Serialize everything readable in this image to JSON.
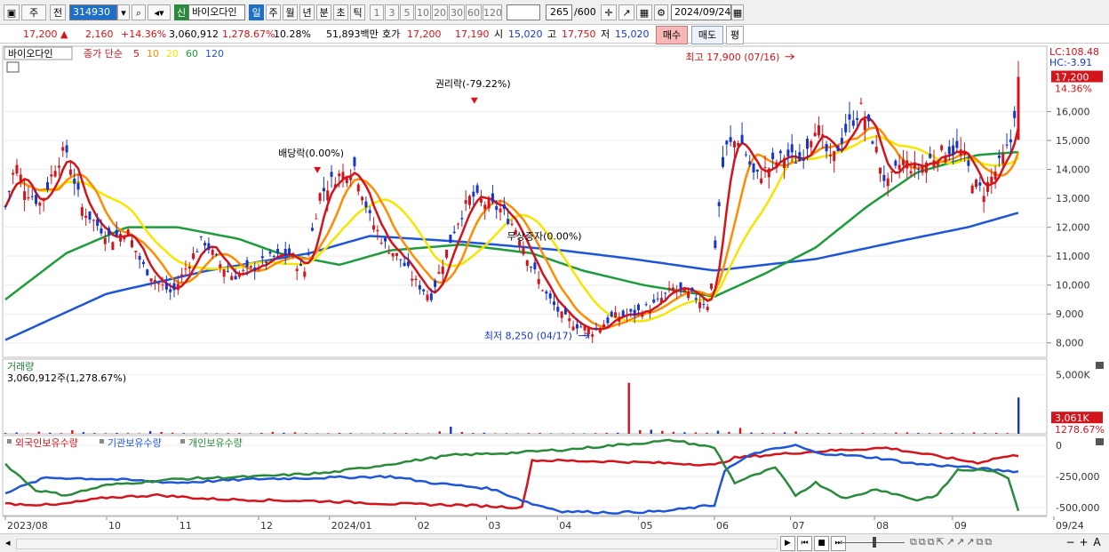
{
  "toolbar": {
    "market": "주",
    "prev_label": "전",
    "code": "314930",
    "stock_name": "바이오다인",
    "new_badge": "신",
    "periods": [
      "일",
      "주",
      "월",
      "년",
      "분",
      "초",
      "틱"
    ],
    "active_period": "일",
    "intervals": [
      "1",
      "3",
      "5",
      "10",
      "20",
      "30",
      "60",
      "120"
    ],
    "count": "265",
    "count_max": "/600",
    "date": "2024/09/24"
  },
  "quote": {
    "price": "17,200",
    "change": "2,160",
    "change_pct": "+14.36%",
    "volume": "3,060,912",
    "volume_pct": "1,278.67%",
    "turnover_pct": "10.28%",
    "amount": "51,893백만",
    "ask_label": "호가",
    "ask": "17,200",
    "bid": "17,190",
    "open_label": "시",
    "open": "15,020",
    "high_label": "고",
    "high": "17,750",
    "low_label": "저",
    "low": "15,020",
    "buy_label": "매수",
    "sell_label": "매도",
    "mode_label": "평"
  },
  "chart_data": {
    "type": "candlestick",
    "title": "바이오다인",
    "legend": {
      "label": "종가 단순",
      "items": [
        {
          "period": "5",
          "color": "#d4141b"
        },
        {
          "period": "10",
          "color": "#ff8c00"
        },
        {
          "period": "20",
          "color": "#f5e600"
        },
        {
          "period": "60",
          "color": "#1e9b3a"
        },
        {
          "period": "120",
          "color": "#1f56d8"
        }
      ]
    },
    "price_axis": {
      "ticks": [
        8000,
        9000,
        10000,
        11000,
        12000,
        13000,
        14000,
        15000,
        16000
      ],
      "tick_labels": [
        "8,000",
        "9,000",
        "10,000",
        "11,000",
        "12,000",
        "13,000",
        "14,000",
        "15,000",
        "16,000"
      ],
      "range": [
        7500,
        18200
      ]
    },
    "lc_label": "LC:108.48",
    "hc_label": "HC:-3.91",
    "current_price_label": "17,200",
    "current_change_label": "14.36%",
    "x_labels": [
      {
        "label": "2023/08",
        "t": 0.0
      },
      {
        "label": "10",
        "t": 0.1
      },
      {
        "label": "11",
        "t": 0.17
      },
      {
        "label": "12",
        "t": 0.25
      },
      {
        "label": "2024/01",
        "t": 0.32
      },
      {
        "label": "02",
        "t": 0.405
      },
      {
        "label": "03",
        "t": 0.475
      },
      {
        "label": "04",
        "t": 0.545
      },
      {
        "label": "05",
        "t": 0.625
      },
      {
        "label": "06",
        "t": 0.7
      },
      {
        "label": "07",
        "t": 0.775
      },
      {
        "label": "08",
        "t": 0.858
      },
      {
        "label": "09",
        "t": 0.935
      },
      {
        "label": "09/24",
        "t": 1.0
      }
    ],
    "close_series": [
      [
        0.0,
        12700
      ],
      [
        0.01,
        14200
      ],
      [
        0.02,
        13300
      ],
      [
        0.035,
        12800
      ],
      [
        0.05,
        14200
      ],
      [
        0.06,
        14700
      ],
      [
        0.075,
        12700
      ],
      [
        0.09,
        12100
      ],
      [
        0.105,
        11600
      ],
      [
        0.12,
        11900
      ],
      [
        0.135,
        10700
      ],
      [
        0.15,
        10100
      ],
      [
        0.165,
        9700
      ],
      [
        0.18,
        10700
      ],
      [
        0.195,
        11600
      ],
      [
        0.21,
        10800
      ],
      [
        0.225,
        10300
      ],
      [
        0.24,
        10500
      ],
      [
        0.26,
        10900
      ],
      [
        0.28,
        11100
      ],
      [
        0.295,
        10400
      ],
      [
        0.31,
        13100
      ],
      [
        0.325,
        13700
      ],
      [
        0.345,
        14100
      ],
      [
        0.36,
        12300
      ],
      [
        0.375,
        11400
      ],
      [
        0.39,
        10900
      ],
      [
        0.405,
        10100
      ],
      [
        0.42,
        9600
      ],
      [
        0.435,
        11100
      ],
      [
        0.445,
        12100
      ],
      [
        0.46,
        13100
      ],
      [
        0.475,
        12800
      ],
      [
        0.49,
        12600
      ],
      [
        0.505,
        11900
      ],
      [
        0.52,
        10600
      ],
      [
        0.535,
        9600
      ],
      [
        0.55,
        8900
      ],
      [
        0.565,
        8600
      ],
      [
        0.58,
        8400
      ],
      [
        0.6,
        8900
      ],
      [
        0.62,
        9000
      ],
      [
        0.64,
        9300
      ],
      [
        0.66,
        9900
      ],
      [
        0.68,
        9600
      ],
      [
        0.695,
        9300
      ],
      [
        0.71,
        14700
      ],
      [
        0.725,
        15100
      ],
      [
        0.74,
        13700
      ],
      [
        0.755,
        14100
      ],
      [
        0.77,
        14500
      ],
      [
        0.785,
        14300
      ],
      [
        0.8,
        15600
      ],
      [
        0.815,
        14200
      ],
      [
        0.83,
        15400
      ],
      [
        0.845,
        16100
      ],
      [
        0.855,
        15200
      ],
      [
        0.87,
        13400
      ],
      [
        0.885,
        14300
      ],
      [
        0.9,
        14000
      ],
      [
        0.915,
        14400
      ],
      [
        0.93,
        14700
      ],
      [
        0.945,
        14600
      ],
      [
        0.955,
        13600
      ],
      [
        0.965,
        13200
      ],
      [
        0.975,
        13800
      ],
      [
        0.985,
        14400
      ],
      [
        0.993,
        15000
      ],
      [
        1.0,
        17200
      ]
    ],
    "ma120": [
      [
        0.0,
        8100
      ],
      [
        0.1,
        9700
      ],
      [
        0.2,
        10500
      ],
      [
        0.3,
        11100
      ],
      [
        0.36,
        11700
      ],
      [
        0.45,
        11500
      ],
      [
        0.55,
        11200
      ],
      [
        0.62,
        10900
      ],
      [
        0.7,
        10500
      ],
      [
        0.8,
        10900
      ],
      [
        0.88,
        11500
      ],
      [
        0.95,
        12000
      ],
      [
        1.0,
        12500
      ]
    ],
    "ma60": [
      [
        0.0,
        9500
      ],
      [
        0.06,
        11100
      ],
      [
        0.12,
        12000
      ],
      [
        0.17,
        12000
      ],
      [
        0.23,
        11600
      ],
      [
        0.27,
        11100
      ],
      [
        0.33,
        10700
      ],
      [
        0.38,
        11200
      ],
      [
        0.45,
        11400
      ],
      [
        0.52,
        11100
      ],
      [
        0.57,
        10500
      ],
      [
        0.63,
        10000
      ],
      [
        0.7,
        9600
      ],
      [
        0.75,
        10400
      ],
      [
        0.8,
        11300
      ],
      [
        0.85,
        12700
      ],
      [
        0.9,
        13900
      ],
      [
        0.96,
        14500
      ],
      [
        1.0,
        14600
      ]
    ],
    "volume_panel": {
      "title": "거래량",
      "subtitle": "3,060,912주(1,278.67%)",
      "tick_labels": [
        "5,000K"
      ],
      "max": 6000,
      "current_label": "3,061K",
      "current_pct": "1278.67%"
    },
    "volume_values": [
      70,
      110,
      40,
      180,
      90,
      60,
      300,
      140,
      70,
      50,
      80,
      60,
      40,
      220,
      150,
      90,
      60,
      30,
      50,
      40,
      60,
      70,
      40,
      80,
      160,
      90,
      130,
      60,
      40,
      50,
      80,
      60,
      30,
      40,
      50,
      60,
      70,
      40,
      30,
      200,
      600,
      150,
      70,
      90,
      40,
      50,
      30,
      60,
      70,
      40,
      30,
      50,
      40,
      60,
      80,
      90,
      4300,
      310,
      340,
      240,
      160,
      130,
      120,
      90,
      260,
      160,
      490,
      110,
      80,
      90,
      120,
      200,
      70,
      70,
      70,
      60,
      50,
      90,
      60,
      40,
      110,
      120,
      80,
      60,
      90,
      70,
      60,
      120,
      60,
      80,
      60,
      3061
    ],
    "holding_panel": {
      "series": [
        {
          "name": "외국인보유수량",
          "color": "#d4141b"
        },
        {
          "name": "기관보유수량",
          "color": "#1f56d8"
        },
        {
          "name": "개인보유수량",
          "color": "#2a8a3c"
        }
      ],
      "tick_labels": [
        "0",
        "-250,000",
        "-500,000"
      ],
      "range": [
        -550000,
        50000
      ]
    },
    "foreign": [
      [
        0.0,
        -470000
      ],
      [
        0.05,
        -480000
      ],
      [
        0.1,
        -420000
      ],
      [
        0.15,
        -400000
      ],
      [
        0.2,
        -430000
      ],
      [
        0.25,
        -440000
      ],
      [
        0.32,
        -450000
      ],
      [
        0.38,
        -470000
      ],
      [
        0.45,
        -480000
      ],
      [
        0.51,
        -500000
      ],
      [
        0.52,
        -120000
      ],
      [
        0.6,
        -130000
      ],
      [
        0.68,
        -150000
      ],
      [
        0.7,
        -160000
      ],
      [
        0.72,
        -100000
      ],
      [
        0.78,
        -60000
      ],
      [
        0.82,
        -40000
      ],
      [
        0.87,
        -20000
      ],
      [
        0.9,
        -60000
      ],
      [
        0.93,
        -100000
      ],
      [
        0.96,
        -140000
      ],
      [
        0.98,
        -100000
      ],
      [
        1.0,
        -80000
      ]
    ],
    "institution": [
      [
        0.0,
        -380000
      ],
      [
        0.04,
        -260000
      ],
      [
        0.1,
        -270000
      ],
      [
        0.17,
        -300000
      ],
      [
        0.25,
        -270000
      ],
      [
        0.32,
        -260000
      ],
      [
        0.38,
        -250000
      ],
      [
        0.42,
        -300000
      ],
      [
        0.48,
        -350000
      ],
      [
        0.52,
        -470000
      ],
      [
        0.55,
        -530000
      ],
      [
        0.6,
        -540000
      ],
      [
        0.65,
        -530000
      ],
      [
        0.7,
        -480000
      ],
      [
        0.71,
        -200000
      ],
      [
        0.74,
        -60000
      ],
      [
        0.78,
        0
      ],
      [
        0.8,
        -60000
      ],
      [
        0.86,
        -100000
      ],
      [
        0.9,
        -150000
      ],
      [
        0.94,
        -170000
      ],
      [
        0.98,
        -200000
      ],
      [
        1.0,
        -210000
      ]
    ],
    "individual": [
      [
        0.0,
        -150000
      ],
      [
        0.03,
        -360000
      ],
      [
        0.06,
        -400000
      ],
      [
        0.1,
        -320000
      ],
      [
        0.17,
        -270000
      ],
      [
        0.25,
        -250000
      ],
      [
        0.32,
        -220000
      ],
      [
        0.38,
        -150000
      ],
      [
        0.44,
        -80000
      ],
      [
        0.5,
        -60000
      ],
      [
        0.56,
        -30000
      ],
      [
        0.6,
        0
      ],
      [
        0.66,
        40000
      ],
      [
        0.7,
        -20000
      ],
      [
        0.72,
        -300000
      ],
      [
        0.76,
        -180000
      ],
      [
        0.78,
        -400000
      ],
      [
        0.8,
        -300000
      ],
      [
        0.83,
        -430000
      ],
      [
        0.86,
        -350000
      ],
      [
        0.9,
        -440000
      ],
      [
        0.92,
        -400000
      ],
      [
        0.94,
        -200000
      ],
      [
        0.97,
        -200000
      ],
      [
        0.99,
        -260000
      ],
      [
        1.0,
        -520000
      ]
    ],
    "annotations": [
      {
        "text": "최고 17,900 (07/16)",
        "t": 0.782,
        "value": 17900,
        "color": "#d4141b"
      },
      {
        "text": "최저 8,250 (04/17)",
        "t": 0.578,
        "value": 8250,
        "color": "#1736c9"
      },
      {
        "text": "권리락(-79.22%)",
        "t": 0.463,
        "value": 16300,
        "color": "#000000"
      },
      {
        "text": "배당락(0.00%)",
        "t": 0.308,
        "value": 13900,
        "color": "#000000"
      },
      {
        "text": "무상증자(0.00%)",
        "t": 0.49,
        "value": 11700,
        "color": "#000000"
      }
    ]
  },
  "bottom": {
    "nav_buttons": [
      "▶",
      "⏮",
      "■",
      "⏭"
    ],
    "zoom_buttons": [
      "−",
      "+",
      "A"
    ]
  }
}
